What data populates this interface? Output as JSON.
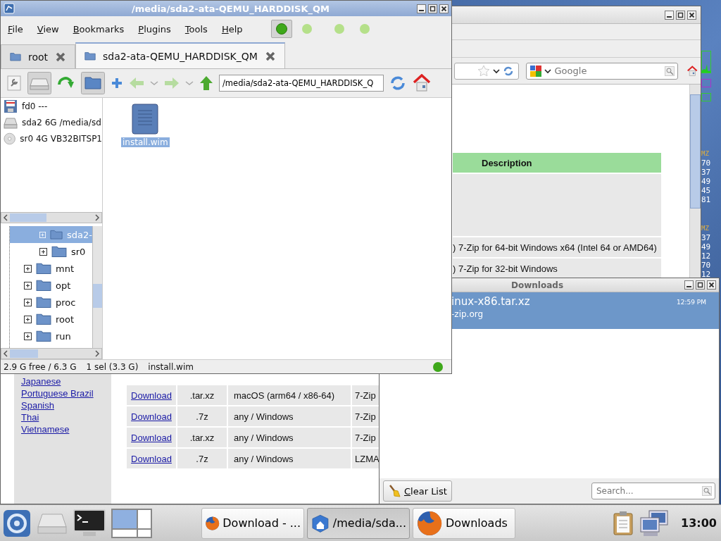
{
  "browser": {
    "search_placeholder": "Google",
    "description_table": {
      "header": "Description",
      "rows": [
        ") 7-Zip for 64-bit Windows x64 (Intel 64 or AMD64)",
        ") 7-Zip for 32-bit Windows"
      ]
    },
    "languages": [
      "Japanese",
      "Portuguese Brazil",
      "Spanish",
      "Thai",
      "Vietnamese"
    ],
    "downloads_table": [
      [
        "Download",
        ".tar.xz",
        "macOS (arm64 / x86-64)",
        "7-Zip"
      ],
      [
        "Download",
        ".7z",
        "any / Windows",
        "7-Zip"
      ],
      [
        "Download",
        ".tar.xz",
        "any / Windows",
        "7-Zip"
      ],
      [
        "Download",
        ".7z",
        "any / Windows",
        "LZMA"
      ]
    ]
  },
  "conky": [
    {
      "label": "MZ",
      "values": [
        "70",
        "37",
        "49",
        "45",
        "81"
      ]
    },
    {
      "label": "MZ",
      "values": [
        "37",
        "49",
        "12",
        "70",
        "12"
      ]
    }
  ],
  "file_manager": {
    "title": "/media/sda2-ata-QEMU_HARDDISK_QM",
    "menu": [
      "File",
      "View",
      "Bookmarks",
      "Plugins",
      "Tools",
      "Help"
    ],
    "view_toggles": [
      {
        "selected": true
      },
      {
        "selected": false
      },
      {
        "selected": false
      },
      {
        "selected": false
      }
    ],
    "tabs": [
      {
        "label": "root",
        "selected": false
      },
      {
        "label": "sda2-ata-QEMU_HARDDISK_QM",
        "selected": true
      }
    ],
    "path": "/media/sda2-ata-QEMU_HARDDISK_Q",
    "devices": [
      {
        "kind": "floppy",
        "label": "fd0 ---"
      },
      {
        "kind": "disk",
        "label": "sda2 6G /media/sd"
      },
      {
        "kind": "cdrom",
        "label": "sr0 4G VB32BITSP1"
      }
    ],
    "tree": [
      {
        "children": [
          {
            "label": "sda2-",
            "selected": true
          },
          {
            "label": "sr0",
            "selected": false
          }
        ]
      },
      {
        "label": "mnt",
        "selected": false
      },
      {
        "label": "opt",
        "selected": false
      },
      {
        "label": "proc",
        "selected": false
      },
      {
        "label": "root",
        "selected": false
      },
      {
        "label": "run",
        "selected": false
      }
    ],
    "files": [
      {
        "name": "install.wim",
        "selected": true
      }
    ],
    "status": [
      "2.9 G free / 6.3 G",
      "1 sel (3.3 G)",
      "install.wim"
    ]
  },
  "downloads": {
    "title": "Downloads",
    "items": [
      {
        "name": "inux-x86.tar.xz",
        "source": "-zip.org",
        "time": "12:59 PM",
        "selected": true
      }
    ],
    "clear_button": "Clear List",
    "search_placeholder": "Search..."
  },
  "taskbar": {
    "workspaces": [
      {
        "selected": true
      },
      {
        "selected": false
      },
      {
        "selected": false
      },
      {
        "selected": false
      }
    ],
    "tasks": [
      {
        "kind": "firefox",
        "label": "Download - ...",
        "selected": false
      },
      {
        "kind": "folder",
        "label": "/media/sda...",
        "selected": true
      },
      {
        "kind": "firefox",
        "label": "Downloads",
        "selected": false
      }
    ],
    "clock": "13:00"
  }
}
